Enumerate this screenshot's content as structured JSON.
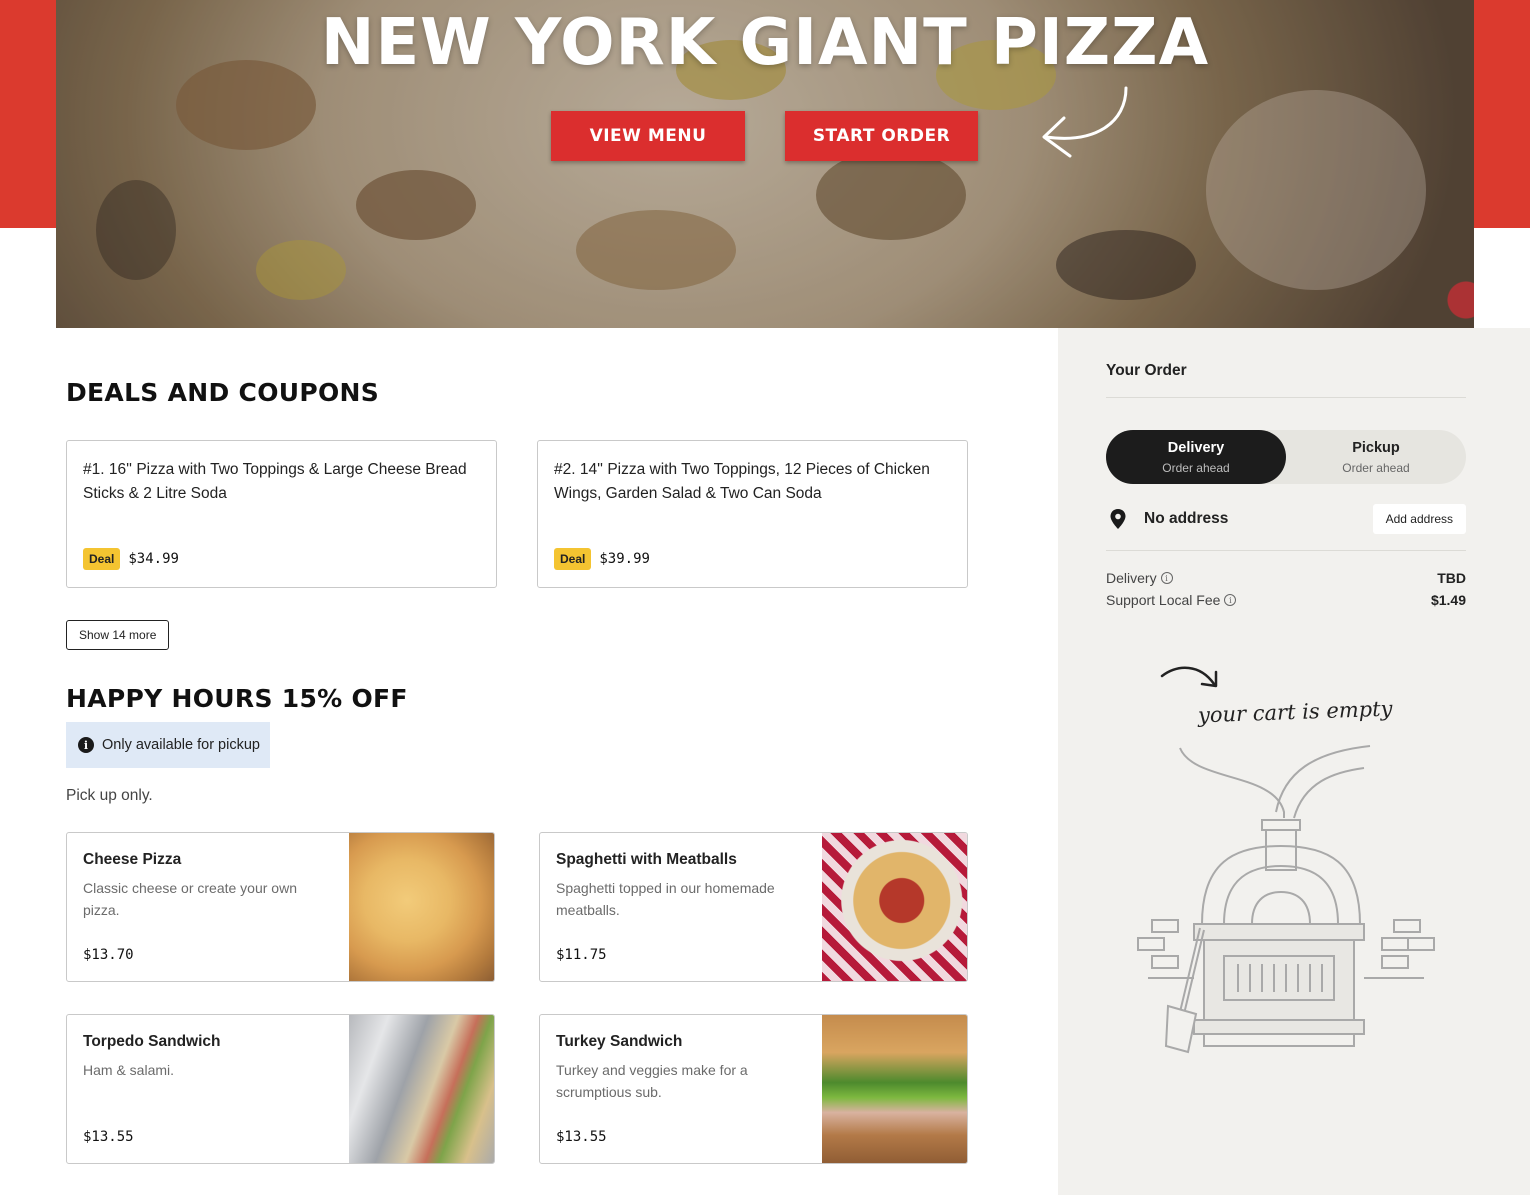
{
  "hero": {
    "title": "NEW YORK GIANT PIZZA",
    "view_menu_label": "VIEW MENU",
    "start_order_label": "START ORDER"
  },
  "deals": {
    "title": "DEALS AND COUPONS",
    "items": [
      {
        "name": "#1. 16'' Pizza with Two Toppings & Large Cheese Bread Sticks & 2 Litre Soda",
        "badge": "Deal",
        "price": "$34.99"
      },
      {
        "name": "#2. 14'' Pizza with Two Toppings, 12 Pieces of Chicken Wings, Garden Salad & Two Can Soda",
        "badge": "Deal",
        "price": "$39.99"
      }
    ],
    "show_more_label": "Show 14 more"
  },
  "happy_hours": {
    "title": "HAPPY HOURS 15% OFF",
    "notice": "Only available for pickup",
    "description": "Pick up only.",
    "items": [
      {
        "name": "Cheese Pizza",
        "description": "Classic cheese or create your own pizza.",
        "price": "$13.70"
      },
      {
        "name": "Spaghetti with Meatballs",
        "description": "Spaghetti topped in our homemade meatballs.",
        "price": "$11.75"
      },
      {
        "name": "Torpedo Sandwich",
        "description": "Ham & salami.",
        "price": "$13.55"
      },
      {
        "name": "Turkey Sandwich",
        "description": "Turkey and veggies make for a scrumptious sub.",
        "price": "$13.55"
      }
    ]
  },
  "order": {
    "title": "Your Order",
    "delivery_label": "Delivery",
    "delivery_sub": "Order ahead",
    "pickup_label": "Pickup",
    "pickup_sub": "Order ahead",
    "address_text": "No address",
    "add_address_label": "Add address",
    "fees": [
      {
        "label": "Delivery",
        "value": "TBD"
      },
      {
        "label": "Support Local Fee",
        "value": "$1.49"
      }
    ],
    "empty_text": "your cart is empty"
  },
  "colors": {
    "brand_red": "#db3a2e",
    "deal_badge": "#f4c431",
    "notice_bg": "#dfe9f6",
    "sidebar_bg": "#f2f1ee"
  }
}
